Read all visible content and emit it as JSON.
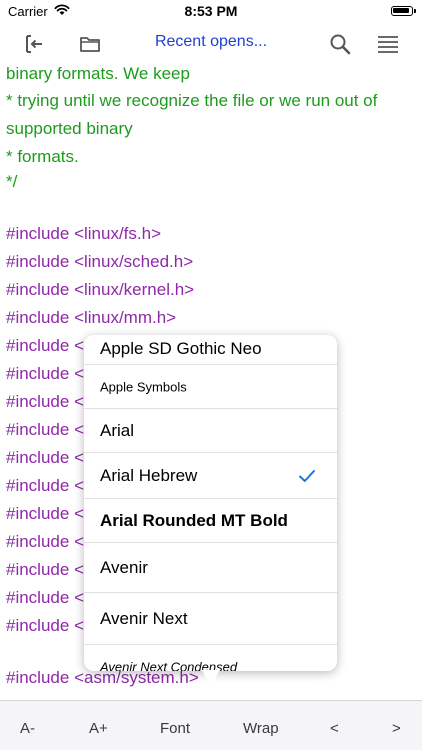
{
  "status": {
    "carrier": "Carrier",
    "time": "8:53 PM"
  },
  "toolbar": {
    "recent_label": "Recent opens..."
  },
  "code": {
    "comment_lines": [
      "binary formats.  We keep",
      " * trying until we recognize the file or we run out of",
      "supported binary",
      " * formats.",
      " */"
    ],
    "include_keyword": "#include",
    "includes": [
      "<linux/fs.h>",
      "<linux/sched.h>",
      "<linux/kernel.h>",
      "<linux/mm.h>",
      "<",
      "<",
      "<",
      "<",
      "<",
      "<",
      "<",
      "<",
      "<",
      "<",
      "<",
      "<asm/system.h>"
    ]
  },
  "font_picker": {
    "options": [
      "Apple SD Gothic Neo",
      "Apple  Symbols",
      "Arial",
      "Arial Hebrew",
      "Arial Rounded MT Bold",
      "Avenir",
      "Avenir Next",
      "Avenir Next Condensed"
    ],
    "selected": "Arial Hebrew",
    "check_color": "#1a73e8"
  },
  "bottom_bar": {
    "decrease": "A-",
    "increase": "A+",
    "font": "Font",
    "wrap": "Wrap",
    "prev": "<",
    "next": ">"
  },
  "colors": {
    "comment": "#1e9b1e",
    "keyword": "#8d2aa6",
    "link": "#1f3fd1"
  }
}
